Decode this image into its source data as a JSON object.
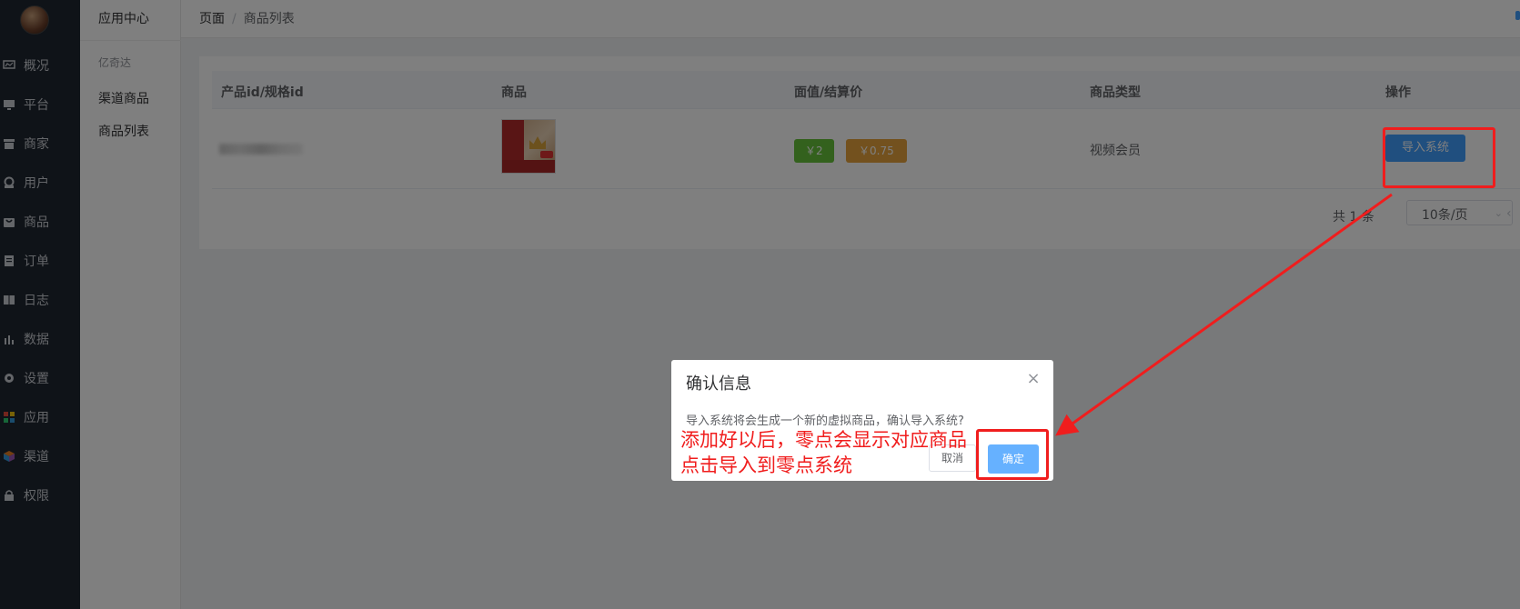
{
  "nav": {
    "items": [
      {
        "label": "概况",
        "icon": "monitor-icon"
      },
      {
        "label": "平台",
        "icon": "desktop-icon"
      },
      {
        "label": "商家",
        "icon": "store-icon"
      },
      {
        "label": "用户",
        "icon": "user-icon"
      },
      {
        "label": "商品",
        "icon": "bag-icon"
      },
      {
        "label": "订单",
        "icon": "clipboard-icon"
      },
      {
        "label": "日志",
        "icon": "book-icon"
      },
      {
        "label": "数据",
        "icon": "bar-chart-icon"
      },
      {
        "label": "设置",
        "icon": "gear-icon"
      },
      {
        "label": "应用",
        "icon": "grid-icon"
      },
      {
        "label": "渠道",
        "icon": "cube-icon"
      },
      {
        "label": "权限",
        "icon": "lock-icon"
      }
    ]
  },
  "subnav": {
    "title": "应用中心",
    "group": "亿奇达",
    "items": [
      "渠道商品",
      "商品列表"
    ]
  },
  "breadcrumb": {
    "root": "页面",
    "sep": "/",
    "current": "商品列表"
  },
  "table": {
    "headers": [
      "产品id/规格id",
      "商品",
      "面值/结算价",
      "商品类型",
      "操作"
    ],
    "row": {
      "face_value": "￥2",
      "settle_price": "￥0.75",
      "type": "视频会员",
      "action": "导入系统"
    }
  },
  "pagination": {
    "total": "共 1 条",
    "page_size": "10条/页"
  },
  "dialog": {
    "title": "确认信息",
    "message": "导入系统将会生成一个新的虚拟商品，确认导入系统?",
    "cancel": "取消",
    "confirm": "确定"
  },
  "annotation": {
    "line1": "添加好以后，零点会显示对应商品",
    "line2": "点击导入到零点系统",
    "color": "#f01d1d"
  },
  "colors": {
    "primary": "#409eff",
    "success": "#67c23a",
    "warning": "#e6a23c",
    "sidebar": "#1e2630"
  }
}
